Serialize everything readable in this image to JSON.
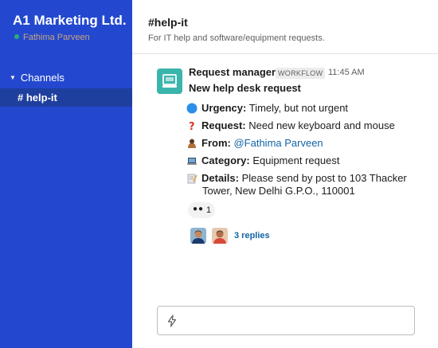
{
  "sidebar": {
    "workspace_name": "A1 Marketing Ltd.",
    "user_name": "Fathima Parveen",
    "channels_header": "Channels",
    "channels": [
      {
        "label": "# help-it",
        "active": true
      }
    ]
  },
  "header": {
    "channel_title": "#help-it",
    "channel_topic": "For IT help and software/equipment requests."
  },
  "message": {
    "sender": "Request manager",
    "badge": "WORKFLOW",
    "timestamp": "11:45 AM",
    "title": "New help desk request",
    "fields": [
      {
        "icon": "blue-circle-icon",
        "label": "Urgency:",
        "value": "Timely, but not urgent"
      },
      {
        "icon": "question-mark-icon",
        "label": "Request:",
        "value": "Need new keyboard and mouse"
      },
      {
        "icon": "person-icon",
        "label": "From:",
        "value": "@Fathima Parveen"
      },
      {
        "icon": "laptop-icon",
        "label": "Category:",
        "value": "Equipment request"
      },
      {
        "icon": "memo-icon",
        "label": "Details:",
        "value": "Please send by post to 103 Thacker",
        "value_line2": "Tower, New Delhi G.P.O., 110001"
      }
    ],
    "reaction": {
      "emoji": "eyes-icon",
      "count": "1"
    },
    "replies_label": "3 replies"
  },
  "composer": {
    "shortcut_icon": "lightning-bolt-icon",
    "placeholder": ""
  },
  "colors": {
    "sidebar_bg": "#2348cf",
    "sidebar_active": "#1e3f9e",
    "link": "#1264a3",
    "bot_avatar": "#3bb5ac"
  }
}
